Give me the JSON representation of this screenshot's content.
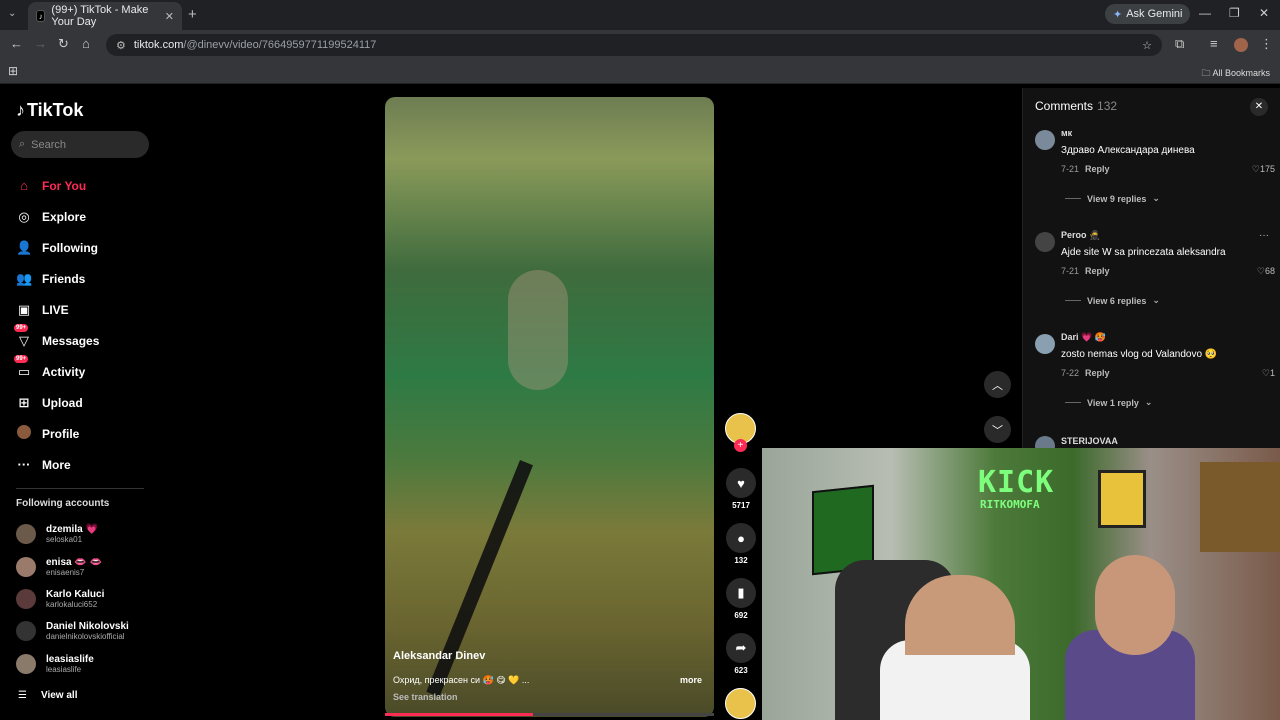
{
  "browser": {
    "tab_title": "(99+) TikTok - Make Your Day",
    "url_host": "tiktok.com",
    "url_path": "/@dinevv/video/7664959771199524117",
    "ask_gemini": "Ask Gemini",
    "all_bookmarks": "All Bookmarks"
  },
  "sidebar": {
    "logo": "TikTok",
    "search_placeholder": "Search",
    "items": [
      {
        "label": "For You",
        "icon": "home-icon"
      },
      {
        "label": "Explore",
        "icon": "compass-icon"
      },
      {
        "label": "Following",
        "icon": "following-icon"
      },
      {
        "label": "Friends",
        "icon": "friends-icon"
      },
      {
        "label": "LIVE",
        "icon": "live-icon"
      },
      {
        "label": "Messages",
        "icon": "messages-icon",
        "badge": "99+"
      },
      {
        "label": "Activity",
        "icon": "activity-icon",
        "badge": "99+"
      },
      {
        "label": "Upload",
        "icon": "upload-icon"
      },
      {
        "label": "Profile",
        "icon": "avatar"
      },
      {
        "label": "More",
        "icon": "more-icon"
      }
    ],
    "following_title": "Following accounts",
    "following": [
      {
        "name": "dzemila 💗",
        "handle": "seloska01",
        "color": "#6b5a4a"
      },
      {
        "name": "enisa 👄 👄",
        "handle": "enisaenis7",
        "color": "#9a7a6a"
      },
      {
        "name": "Karlo Kaluci",
        "handle": "karlokaluci652",
        "color": "#5a3a3a"
      },
      {
        "name": "Daniel Nikolovski",
        "handle": "danielnikolovskiofficial",
        "color": "#333333"
      },
      {
        "name": "leasiaslife",
        "handle": "leasiaslife",
        "color": "#8a7a6a"
      }
    ],
    "view_all": "View all"
  },
  "video": {
    "author": "Aleksandar Dinev",
    "description": "Охрид, прекрасен си 🥵 😋 💛 ...",
    "more": "more",
    "see_translation": "See translation",
    "progress": 0.45
  },
  "actions": {
    "likes": "5717",
    "comments": "132",
    "saves": "692",
    "shares": "623"
  },
  "comments": {
    "title": "Comments",
    "count": "132",
    "items": [
      {
        "user": "мк",
        "text": "Здраво Александара динева",
        "date": "7-21",
        "reply": "Reply",
        "likes": "175",
        "view_replies": "View 9 replies",
        "avatar_color": "#7a8a9a"
      },
      {
        "user": "Peroo 🥷",
        "text": "Ajde site W sa princezata aleksandra",
        "date": "7-21",
        "reply": "Reply",
        "likes": "68",
        "view_replies": "View 6 replies",
        "avatar_color": "#444444"
      },
      {
        "user": "Dari 💗 🥵",
        "text": "zosto nemas vlog od Valandovo 🥺",
        "date": "7-22",
        "reply": "Reply",
        "likes": "1",
        "view_replies": "View 1 reply",
        "avatar_color": "#8aa0b0"
      },
      {
        "user": "STERIJOVAA",
        "text": "",
        "date": "",
        "reply": "",
        "likes": "",
        "view_replies": "",
        "avatar_color": "#6a7a8a"
      }
    ]
  },
  "webcam": {
    "sign_line1": "KICK",
    "sign_line2": "RITKOMOFA"
  }
}
